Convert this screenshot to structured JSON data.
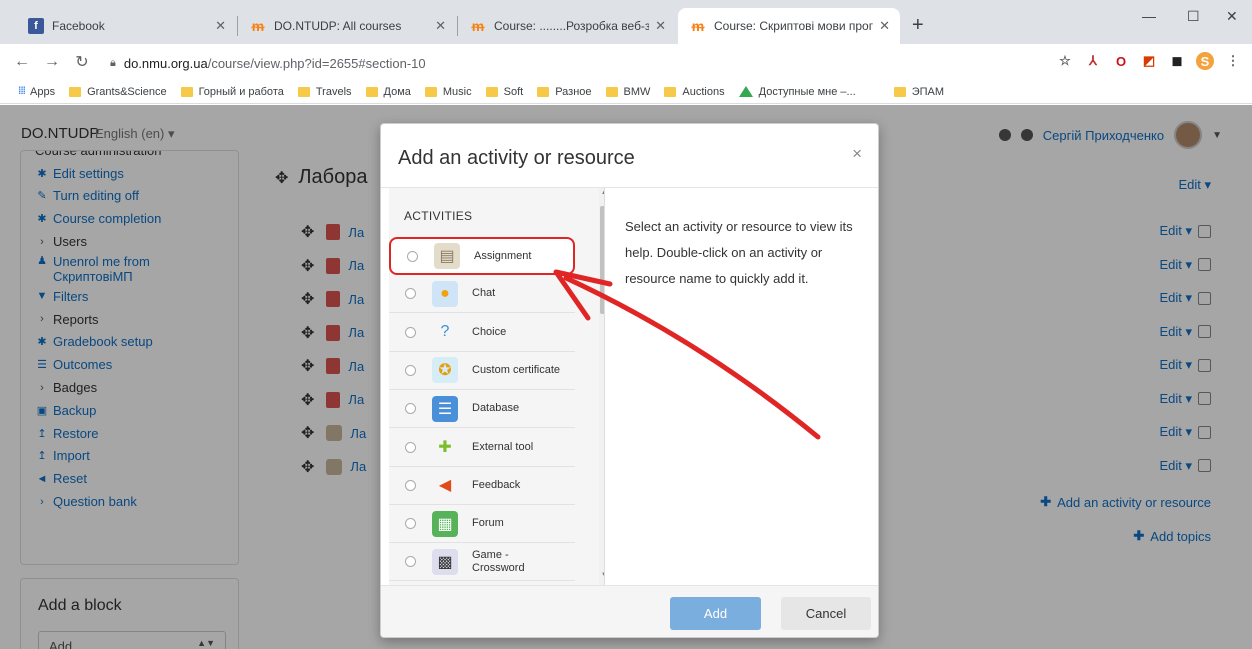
{
  "browser": {
    "tabs": [
      {
        "title": "Facebook",
        "icon": "facebook-icon"
      },
      {
        "title": "DO.NTUDP: All courses",
        "icon": "moodle-icon"
      },
      {
        "title": "Course: ........Розробка веб-засто",
        "icon": "moodle-icon"
      },
      {
        "title": "Course: Скриптові мови програ",
        "icon": "moodle-icon"
      }
    ],
    "new_tab": "+",
    "url_host": "do.nmu.org.ua",
    "url_path": "/course/view.php?id=2655#section-10",
    "bookmarks": [
      "Apps",
      "Grants&Science",
      "Горный и работа",
      "Travels",
      "Дома",
      "Music",
      "Soft",
      "Разное",
      "BMW",
      "Auctions",
      "Доступные мне –...",
      "ЭПАМ"
    ]
  },
  "navbar": {
    "brand": "DO.NTUDP",
    "language": "English (en) ▾",
    "user": "Сергій Приходченко"
  },
  "sidebar": {
    "items": [
      {
        "label": "Course administration",
        "icon": "",
        "plain": true
      },
      {
        "label": "Edit settings",
        "icon": "gear-icon"
      },
      {
        "label": "Turn editing off",
        "icon": "pencil-icon"
      },
      {
        "label": "Course completion",
        "icon": "gear-icon"
      },
      {
        "label": "Users",
        "icon": "chevron-right-icon",
        "plain": true
      },
      {
        "label": "Unenrol me from СкриптовіМП",
        "icon": "user-icon",
        "wrap": true
      },
      {
        "label": "Filters",
        "icon": "filter-icon"
      },
      {
        "label": "Reports",
        "icon": "chevron-right-icon",
        "plain": true
      },
      {
        "label": "Gradebook setup",
        "icon": "gear-icon"
      },
      {
        "label": "Outcomes",
        "icon": "list-icon"
      },
      {
        "label": "Badges",
        "icon": "chevron-right-icon",
        "plain": true
      },
      {
        "label": "Backup",
        "icon": "backup-icon"
      },
      {
        "label": "Restore",
        "icon": "upload-icon"
      },
      {
        "label": "Import",
        "icon": "upload-icon"
      },
      {
        "label": "Reset",
        "icon": "arrow-left-icon"
      },
      {
        "label": "Question bank",
        "icon": "chevron-right-icon"
      }
    ]
  },
  "add_block": {
    "title": "Add a block",
    "select_value": "Add..."
  },
  "content": {
    "section_title": "Лабора",
    "activity_prefix": "Ла",
    "edit_label": "Edit ▾",
    "add_activity": "Add an activity or resource",
    "add_topics": "Add topics"
  },
  "modal": {
    "title": "Add an activity or resource",
    "close": "×",
    "section_heading": "ACTIVITIES",
    "options": [
      {
        "label": "Assignment",
        "icon": "assignment-icon"
      },
      {
        "label": "Chat",
        "icon": "chat-icon"
      },
      {
        "label": "Choice",
        "icon": "choice-icon"
      },
      {
        "label": "Custom certificate",
        "icon": "certificate-icon"
      },
      {
        "label": "Database",
        "icon": "database-icon"
      },
      {
        "label": "External tool",
        "icon": "puzzle-icon"
      },
      {
        "label": "Feedback",
        "icon": "megaphone-icon"
      },
      {
        "label": "Forum",
        "icon": "forum-icon"
      },
      {
        "label": "Game - Crossword",
        "icon": "crossword-icon"
      }
    ],
    "help_text": "Select an activity or resource to view its help. Double-click on an activity or resource name to quickly add it.",
    "add_button": "Add",
    "cancel_button": "Cancel"
  },
  "colors": {
    "link": "#0f6fc5",
    "add_button": "#7aaede",
    "annotation": "#e02525"
  }
}
